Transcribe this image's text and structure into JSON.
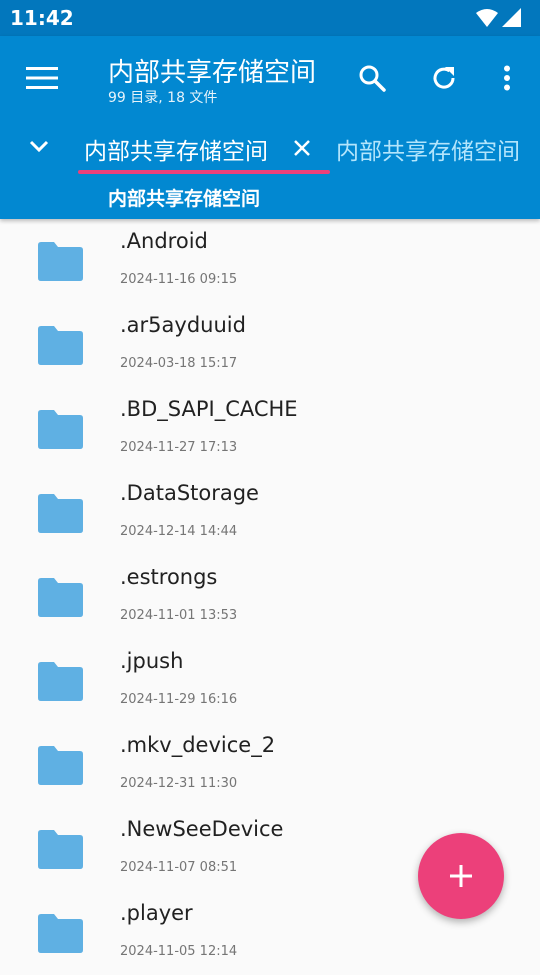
{
  "status": {
    "time": "11:42"
  },
  "appbar": {
    "title": "内部共享存储空间",
    "subtitle": "99 目录, 18 文件",
    "tabs": [
      {
        "label": "内部共享存储空间",
        "active": true
      },
      {
        "label": "内部共享存储空间",
        "active": false
      }
    ],
    "breadcrumb": "内部共享存储空间",
    "icons": [
      "menu-icon",
      "search-icon",
      "refresh-icon",
      "more-vert-icon",
      "chevron-down-icon",
      "close-icon"
    ]
  },
  "files": [
    {
      "name": ".Android",
      "date": "2024-11-16 09:15"
    },
    {
      "name": ".ar5ayduuid",
      "date": "2024-03-18 15:17"
    },
    {
      "name": ".BD_SAPI_CACHE",
      "date": "2024-11-27 17:13"
    },
    {
      "name": ".DataStorage",
      "date": "2024-12-14 14:44"
    },
    {
      "name": ".estrongs",
      "date": "2024-11-01 13:53"
    },
    {
      "name": ".jpush",
      "date": "2024-11-29 16:16"
    },
    {
      "name": ".mkv_device_2",
      "date": "2024-12-31 11:30"
    },
    {
      "name": ".NewSeeDevice",
      "date": "2024-11-07 08:51"
    },
    {
      "name": ".player",
      "date": "2024-11-05 12:14"
    }
  ],
  "colors": {
    "appbar": "#0288d1",
    "statusbar": "#0277bd",
    "accent": "#ec407a",
    "folder": "#5fb0e3"
  }
}
